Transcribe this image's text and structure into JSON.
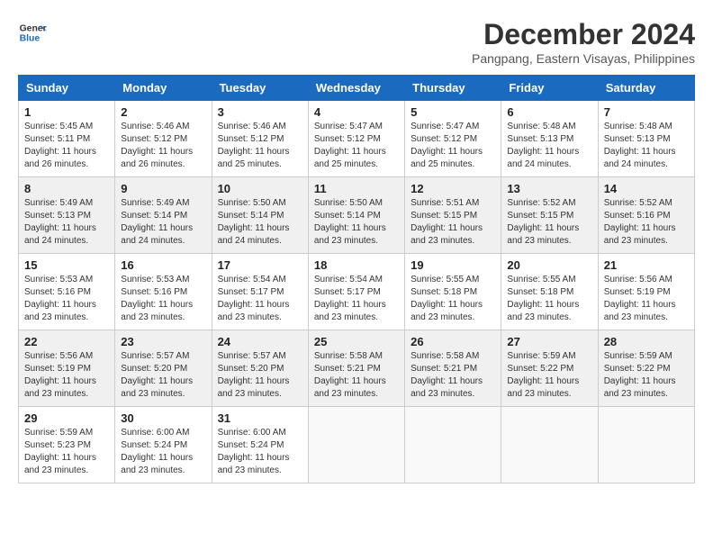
{
  "logo": {
    "text_general": "General",
    "text_blue": "Blue"
  },
  "title": {
    "month_year": "December 2024",
    "location": "Pangpang, Eastern Visayas, Philippines"
  },
  "weekdays": [
    "Sunday",
    "Monday",
    "Tuesday",
    "Wednesday",
    "Thursday",
    "Friday",
    "Saturday"
  ],
  "weeks": [
    [
      {
        "day": "1",
        "info": "Sunrise: 5:45 AM\nSunset: 5:11 PM\nDaylight: 11 hours\nand 26 minutes."
      },
      {
        "day": "2",
        "info": "Sunrise: 5:46 AM\nSunset: 5:12 PM\nDaylight: 11 hours\nand 26 minutes."
      },
      {
        "day": "3",
        "info": "Sunrise: 5:46 AM\nSunset: 5:12 PM\nDaylight: 11 hours\nand 25 minutes."
      },
      {
        "day": "4",
        "info": "Sunrise: 5:47 AM\nSunset: 5:12 PM\nDaylight: 11 hours\nand 25 minutes."
      },
      {
        "day": "5",
        "info": "Sunrise: 5:47 AM\nSunset: 5:12 PM\nDaylight: 11 hours\nand 25 minutes."
      },
      {
        "day": "6",
        "info": "Sunrise: 5:48 AM\nSunset: 5:13 PM\nDaylight: 11 hours\nand 24 minutes."
      },
      {
        "day": "7",
        "info": "Sunrise: 5:48 AM\nSunset: 5:13 PM\nDaylight: 11 hours\nand 24 minutes."
      }
    ],
    [
      {
        "day": "8",
        "info": "Sunrise: 5:49 AM\nSunset: 5:13 PM\nDaylight: 11 hours\nand 24 minutes."
      },
      {
        "day": "9",
        "info": "Sunrise: 5:49 AM\nSunset: 5:14 PM\nDaylight: 11 hours\nand 24 minutes."
      },
      {
        "day": "10",
        "info": "Sunrise: 5:50 AM\nSunset: 5:14 PM\nDaylight: 11 hours\nand 24 minutes."
      },
      {
        "day": "11",
        "info": "Sunrise: 5:50 AM\nSunset: 5:14 PM\nDaylight: 11 hours\nand 23 minutes."
      },
      {
        "day": "12",
        "info": "Sunrise: 5:51 AM\nSunset: 5:15 PM\nDaylight: 11 hours\nand 23 minutes."
      },
      {
        "day": "13",
        "info": "Sunrise: 5:52 AM\nSunset: 5:15 PM\nDaylight: 11 hours\nand 23 minutes."
      },
      {
        "day": "14",
        "info": "Sunrise: 5:52 AM\nSunset: 5:16 PM\nDaylight: 11 hours\nand 23 minutes."
      }
    ],
    [
      {
        "day": "15",
        "info": "Sunrise: 5:53 AM\nSunset: 5:16 PM\nDaylight: 11 hours\nand 23 minutes."
      },
      {
        "day": "16",
        "info": "Sunrise: 5:53 AM\nSunset: 5:16 PM\nDaylight: 11 hours\nand 23 minutes."
      },
      {
        "day": "17",
        "info": "Sunrise: 5:54 AM\nSunset: 5:17 PM\nDaylight: 11 hours\nand 23 minutes."
      },
      {
        "day": "18",
        "info": "Sunrise: 5:54 AM\nSunset: 5:17 PM\nDaylight: 11 hours\nand 23 minutes."
      },
      {
        "day": "19",
        "info": "Sunrise: 5:55 AM\nSunset: 5:18 PM\nDaylight: 11 hours\nand 23 minutes."
      },
      {
        "day": "20",
        "info": "Sunrise: 5:55 AM\nSunset: 5:18 PM\nDaylight: 11 hours\nand 23 minutes."
      },
      {
        "day": "21",
        "info": "Sunrise: 5:56 AM\nSunset: 5:19 PM\nDaylight: 11 hours\nand 23 minutes."
      }
    ],
    [
      {
        "day": "22",
        "info": "Sunrise: 5:56 AM\nSunset: 5:19 PM\nDaylight: 11 hours\nand 23 minutes."
      },
      {
        "day": "23",
        "info": "Sunrise: 5:57 AM\nSunset: 5:20 PM\nDaylight: 11 hours\nand 23 minutes."
      },
      {
        "day": "24",
        "info": "Sunrise: 5:57 AM\nSunset: 5:20 PM\nDaylight: 11 hours\nand 23 minutes."
      },
      {
        "day": "25",
        "info": "Sunrise: 5:58 AM\nSunset: 5:21 PM\nDaylight: 11 hours\nand 23 minutes."
      },
      {
        "day": "26",
        "info": "Sunrise: 5:58 AM\nSunset: 5:21 PM\nDaylight: 11 hours\nand 23 minutes."
      },
      {
        "day": "27",
        "info": "Sunrise: 5:59 AM\nSunset: 5:22 PM\nDaylight: 11 hours\nand 23 minutes."
      },
      {
        "day": "28",
        "info": "Sunrise: 5:59 AM\nSunset: 5:22 PM\nDaylight: 11 hours\nand 23 minutes."
      }
    ],
    [
      {
        "day": "29",
        "info": "Sunrise: 5:59 AM\nSunset: 5:23 PM\nDaylight: 11 hours\nand 23 minutes."
      },
      {
        "day": "30",
        "info": "Sunrise: 6:00 AM\nSunset: 5:24 PM\nDaylight: 11 hours\nand 23 minutes."
      },
      {
        "day": "31",
        "info": "Sunrise: 6:00 AM\nSunset: 5:24 PM\nDaylight: 11 hours\nand 23 minutes."
      },
      {
        "day": "",
        "info": ""
      },
      {
        "day": "",
        "info": ""
      },
      {
        "day": "",
        "info": ""
      },
      {
        "day": "",
        "info": ""
      }
    ]
  ]
}
